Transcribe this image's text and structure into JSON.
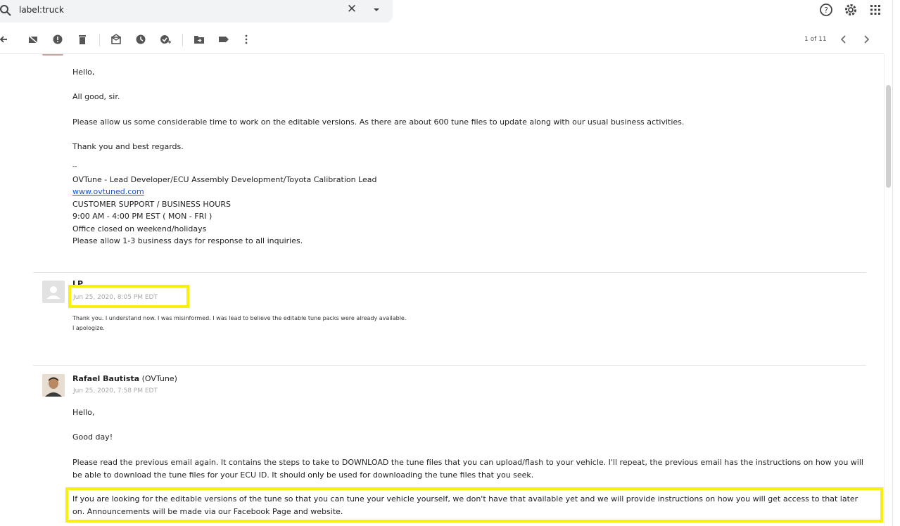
{
  "search": {
    "query": "label:truck"
  },
  "toolbar": {
    "pager": "1 of 11"
  },
  "messages": {
    "first": {
      "greeting": "Hello,",
      "line1": "All good, sir.",
      "line2": "Please allow us some considerable time to work on the editable versions. As there are about 600 tune files to update along with our usual business activities.",
      "line3": "Thank you and best regards.",
      "sig_dash": "--",
      "sig_title": "OVTune - Lead Developer/ECU Assembly Development/Toyota Calibration Lead",
      "sig_link": "www.ovtuned.com",
      "sig_hours_label": "CUSTOMER SUPPORT / BUSINESS HOURS",
      "sig_hours": "9:00 AM - 4:00 PM EST ( MON - FRI )",
      "sig_closed": "Office closed on weekend/holidays",
      "sig_response": "Please allow 1-3 business days for response to all inquiries."
    },
    "second": {
      "sender": "LP",
      "date": "Jun 25, 2020, 8:05 PM EDT",
      "line1": "Thank you. I understand now. I was misinformed. I was lead to believe the editable tune packs were already available.",
      "line2": "I apologize."
    },
    "third": {
      "sender_name": "Rafael Bautista",
      "sender_org": "(OVTune)",
      "date": "Jun 25, 2020, 7:58 PM EDT",
      "greeting": "Hello,",
      "line1": "Good day!",
      "para1": "Please read the previous email again. It contains the steps to take to DOWNLOAD the tune files that you can upload/flash to your vehicle. I'll repeat, the previous email has the instructions on how you will be able to download the tune files for your ECU ID. It should only be used for downloading the tune files that you seek.",
      "para2": "If you are looking for the editable versions of the tune so that you can tune your vehicle yourself, we don't have that available yet and we will provide instructions on how you will get access to that later on. Announcements will be made via our Facebook Page and website."
    }
  },
  "colors": {
    "highlight": "#f8ef0f",
    "link": "#1a57c9"
  }
}
